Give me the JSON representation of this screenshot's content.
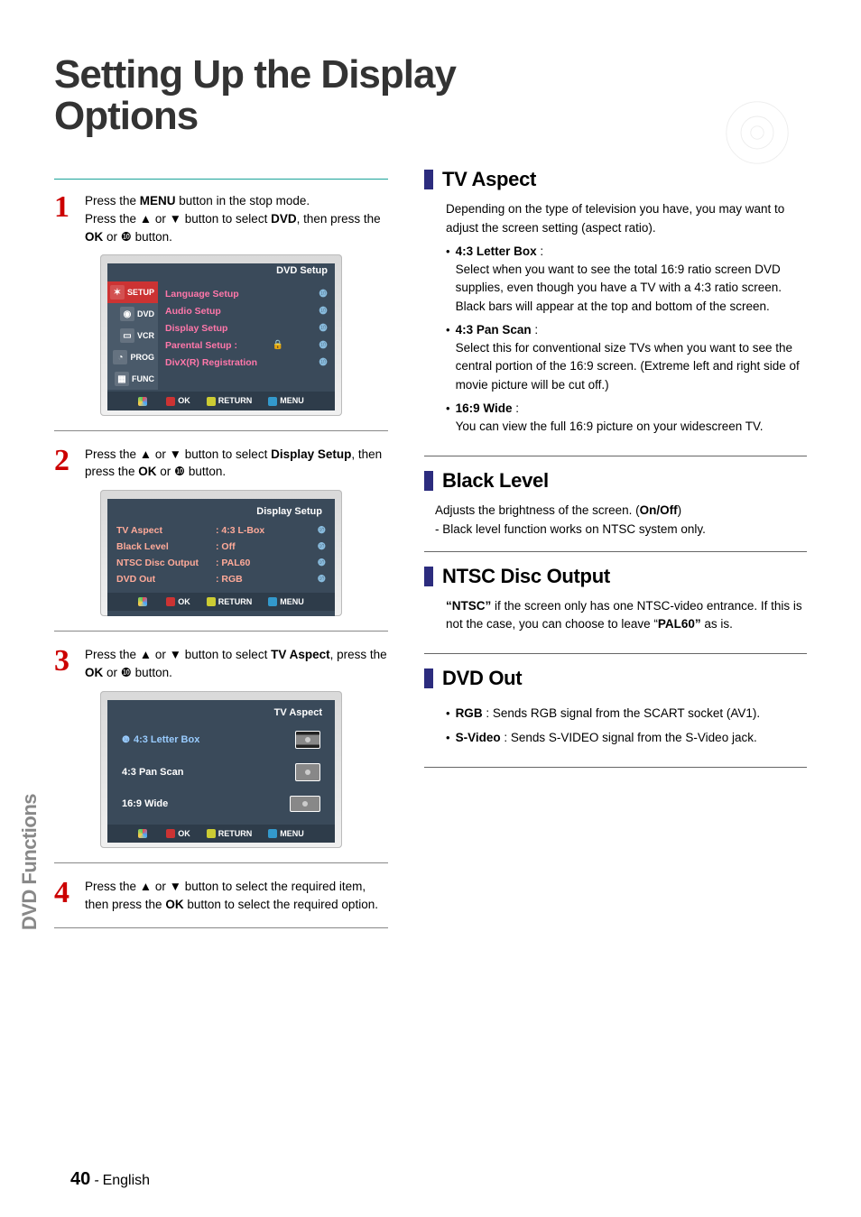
{
  "page": {
    "title_line1": "Setting Up the Display",
    "title_line2": "Options",
    "side_tab": "DVD Functions",
    "footer_page": "40",
    "footer_lang": "English"
  },
  "steps": {
    "s1": {
      "num": "1",
      "l1a": "Press the ",
      "l1b": "MENU",
      "l1c": " button in the stop mode.",
      "l2a": "Press the ▲ or ▼ button to select ",
      "l2b": "DVD",
      "l2c": ", then press the ",
      "l2d": "OK",
      "l2e": " or ❿ button."
    },
    "s2": {
      "num": "2",
      "l1a": "Press the ▲ or ▼ button to select ",
      "l1b": "Display Setup",
      "l1c": ", then press the ",
      "l1d": "OK",
      "l1e": " or ❿ button."
    },
    "s3": {
      "num": "3",
      "l1a": "Press the ▲ or ▼ button to select ",
      "l1b": "TV Aspect",
      "l1c": ", press the ",
      "l1d": "OK",
      "l1e": " or ❿ button."
    },
    "s4": {
      "num": "4",
      "l1a": "Press the ▲ or ▼ button to select the required item, then press the ",
      "l1b": "OK",
      "l1c": " button to select the required option."
    }
  },
  "osd1": {
    "header": "DVD  Setup",
    "side": [
      "SETUP",
      "DVD",
      "VCR",
      "PROG",
      "FUNC"
    ],
    "rows": [
      "Language Setup",
      "Audio Setup",
      "Display Setup",
      "Parental Setup :",
      "DivX(R) Registration"
    ],
    "bottom_ok": "OK",
    "bottom_return": "RETURN",
    "bottom_menu": "MENU"
  },
  "osd2": {
    "header": "Display Setup",
    "rows": [
      {
        "label": "TV Aspect",
        "value": ": 4:3 L-Box"
      },
      {
        "label": "Black Level",
        "value": ": Off"
      },
      {
        "label": "NTSC Disc Output",
        "value": ": PAL60"
      },
      {
        "label": "DVD Out",
        "value": ": RGB"
      }
    ],
    "bottom_ok": "OK",
    "bottom_return": "RETURN",
    "bottom_menu": "MENU"
  },
  "osd3": {
    "header": "TV Aspect",
    "rows": [
      "4:3 Letter Box",
      "4:3 Pan Scan",
      "16:9 Wide"
    ],
    "bottom_ok": "OK",
    "bottom_return": "RETURN",
    "bottom_menu": "MENU"
  },
  "right": {
    "tv_aspect": {
      "title": "TV Aspect",
      "intro": "Depending on the type of television you have, you may want to adjust the screen setting (aspect ratio).",
      "b1_label": "4:3 Letter Box",
      "b1_colon": " :",
      "b1_desc": "Select when you want to see the total 16:9 ratio screen DVD  supplies, even  though you have a TV with a 4:3 ratio screen. Black bars will appear at the top and bottom of the screen.",
      "b2_label": "4:3 Pan Scan",
      "b2_colon": " :",
      "b2_desc": "Select this for conventional size TVs when you want to see the central portion of the 16:9 screen. (Extreme left and right  side  of movie picture will be cut off.)",
      "b3_label": "16:9 Wide",
      "b3_colon": " :",
      "b3_desc": "You can view the full 16:9 picture on your widescreen TV."
    },
    "black_level": {
      "title": "Black Level",
      "l1a": "Adjusts the brightness of the screen. (",
      "l1b": "On/Off",
      "l1c": ")",
      "l2": " - Black level function works on NTSC system only."
    },
    "ntsc": {
      "title": "NTSC Disc Output",
      "t1": "“NTSC”",
      "t2": " if the screen only has one NTSC-video entrance. If this is not the case, you can choose to leave “",
      "t3": "PAL60”",
      "t4": " as is."
    },
    "dvd_out": {
      "title": "DVD Out",
      "r1_label": "RGB",
      "r1_text": " : Sends RGB signal from the SCART socket (AV1).",
      "r2_label": "S-Video",
      "r2_text": " : Sends S-VIDEO signal from the S-Video jack."
    }
  }
}
